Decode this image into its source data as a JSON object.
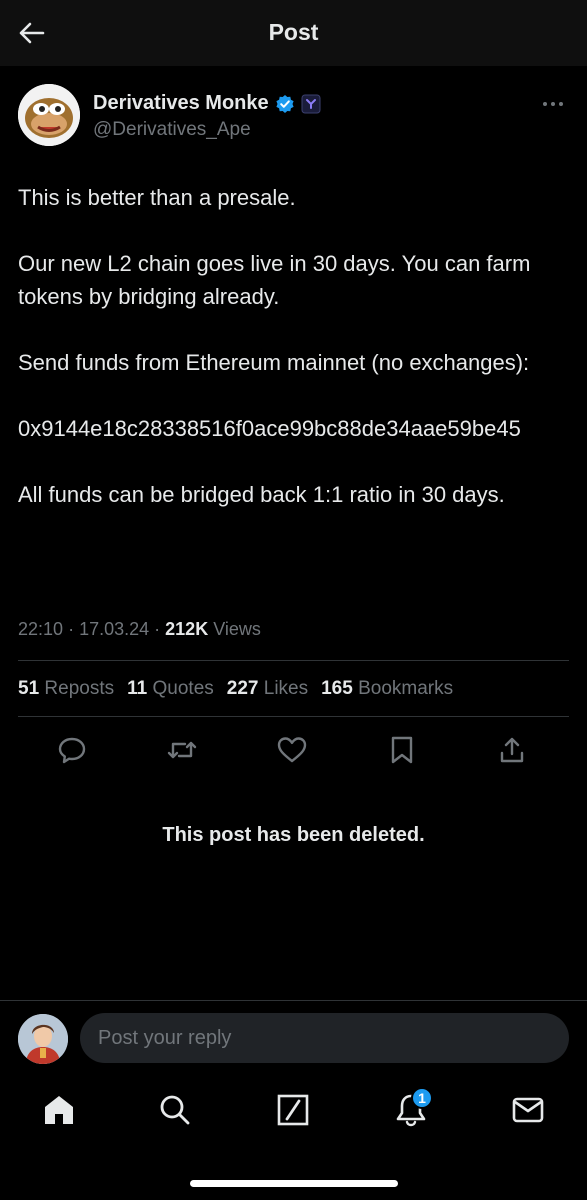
{
  "header": {
    "title": "Post"
  },
  "author": {
    "display_name": "Derivatives Monke",
    "handle": "@Derivatives_Ape"
  },
  "post": {
    "paragraphs": [
      "This is better than a presale.",
      "Our new L2 chain goes live in 30 days. You can farm tokens by bridging already.",
      "Send funds from Ethereum mainnet (no exchanges):",
      "0x9144e18c28338516f0ace99bc88de34aae59be45",
      "All funds can be bridged back 1:1 ratio in 30 days."
    ],
    "time": "22:10",
    "date": "17.03.24",
    "views_count": "212K",
    "views_label": "Views"
  },
  "stats": {
    "reposts_count": "51",
    "reposts_label": "Reposts",
    "quotes_count": "11",
    "quotes_label": "Quotes",
    "likes_count": "227",
    "likes_label": "Likes",
    "bookmarks_count": "165",
    "bookmarks_label": "Bookmarks"
  },
  "deleted_notice": "This post has been deleted.",
  "reply": {
    "placeholder": "Post your reply"
  },
  "nav": {
    "notifications_badge": "1"
  },
  "colors": {
    "background": "#000000",
    "text": "#e7e9ea",
    "muted": "#71767b",
    "accent": "#1d9bf0",
    "divider": "#2f3336"
  },
  "icons": [
    "back-arrow-icon",
    "verified-icon",
    "affiliate-badge-icon",
    "more-icon",
    "reply-icon",
    "repost-icon",
    "like-icon",
    "bookmark-icon",
    "share-icon",
    "home-icon",
    "search-icon",
    "compose-icon",
    "notifications-icon",
    "messages-icon"
  ]
}
